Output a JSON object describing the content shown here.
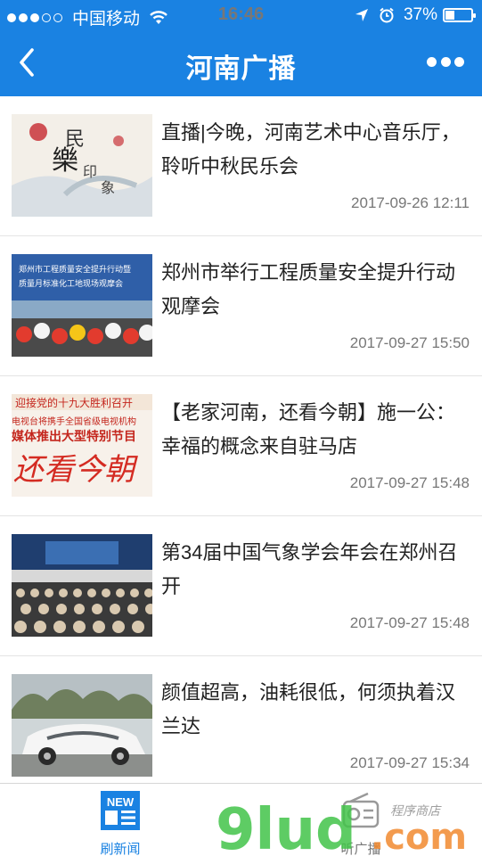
{
  "status_bar": {
    "carrier": "中国移动",
    "time": "16:46",
    "battery": "37%",
    "battery_level": 0.37
  },
  "nav": {
    "title": "河南广播",
    "back_icon": "chevron-left-icon",
    "more_icon": "more-dots-icon"
  },
  "news": [
    {
      "title": "直播|今晚，河南艺术中心音乐厅，聆听中秋民乐会",
      "time": "2017-09-26 12:11"
    },
    {
      "title": "郑州市举行工程质量安全提升行动观摩会",
      "time": "2017-09-27 15:50"
    },
    {
      "title": "【老家河南，还看今朝】施一公：幸福的概念来自驻马店",
      "time": "2017-09-27 15:48"
    },
    {
      "title": "第34届中国气象学会年会在郑州召开",
      "time": "2017-09-27 15:48"
    },
    {
      "title": "颜值超高，油耗很低，何须执着汉兰达",
      "time": "2017-09-27 15:34"
    }
  ],
  "tabs": {
    "news_label": "刷新闻",
    "news_icon_text": "NEW",
    "radio_label": "听广播"
  },
  "thumb_text": {
    "t1_a": "民",
    "t1_b": "樂",
    "t1_c": "印",
    "t1_d": "象",
    "t2_a": "郑州市工程质量安全提升行动暨",
    "t2_b": "质量月标准化工地现场观摩会",
    "t3_a": "迎接党的十九大胜利召开",
    "t3_b": "电视台将携手全国省级电视机构",
    "t3_c": "媒体推出大型特别节目",
    "t3_d": "还看今朝"
  },
  "watermark": {
    "logo": "9lud",
    "domain": ".com",
    "slogan": "程序商店"
  },
  "colors": {
    "brand": "#1a82e2",
    "text": "#222222",
    "muted": "#777777"
  }
}
